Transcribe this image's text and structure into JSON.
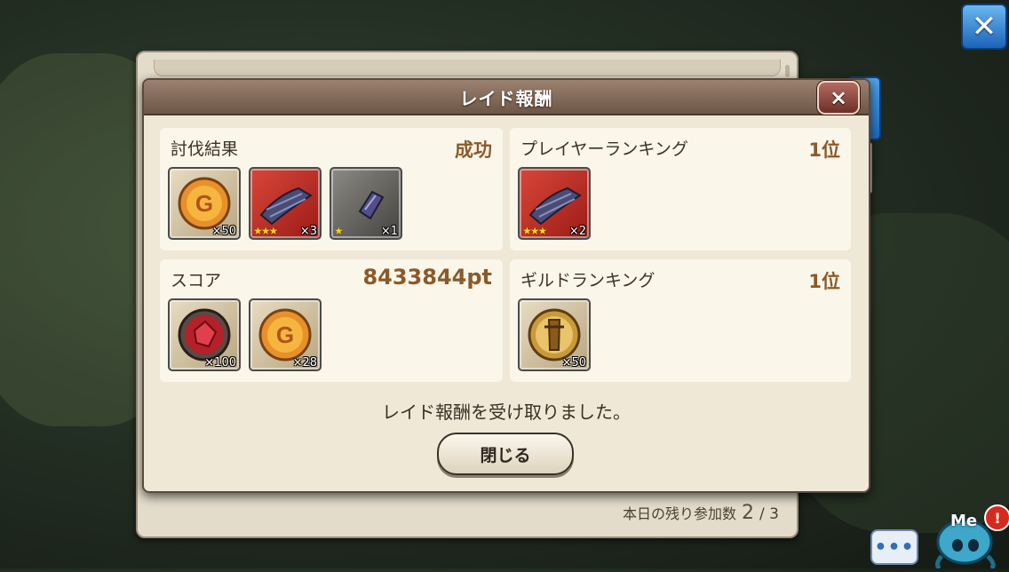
{
  "dialog": {
    "title": "レイド報酬",
    "close_icon": "×",
    "message": "レイド報酬を受け取りました。",
    "close_button_label": "閉じる"
  },
  "cards": {
    "subjugation": {
      "title": "討伐結果",
      "value": "成功",
      "items": [
        {
          "icon": "gold-coin-icon",
          "qty": "×50"
        },
        {
          "icon": "cloth-material-icon",
          "stars": "★★★",
          "qty": "×3"
        },
        {
          "icon": "cloth-scrap-icon",
          "stars": "★",
          "qty": "×1"
        }
      ]
    },
    "player_ranking": {
      "title": "プレイヤーランキング",
      "value": "1位",
      "items": [
        {
          "icon": "cloth-material-icon",
          "stars": "★★★",
          "qty": "×2"
        }
      ]
    },
    "score": {
      "title": "スコア",
      "value": "8433844pt",
      "items": [
        {
          "icon": "red-gem-icon",
          "qty": "×100"
        },
        {
          "icon": "gold-coin-icon",
          "qty": "×28"
        }
      ]
    },
    "guild_ranking": {
      "title": "ギルドランキング",
      "value": "1位",
      "items": [
        {
          "icon": "guild-medal-icon",
          "qty": "×50"
        }
      ]
    }
  },
  "daily": {
    "label": "本日の残り参加数",
    "current": "2",
    "total": "/ 3"
  },
  "top_close_icon": "✕",
  "chat_icon": "•••",
  "mascot": {
    "label": "Me",
    "badge": "!"
  },
  "colors": {
    "header_brown": "#8a705f",
    "value_text": "#8a5a2b",
    "close_red": "#8e3b32",
    "accent_blue": "#2f7fd0"
  }
}
